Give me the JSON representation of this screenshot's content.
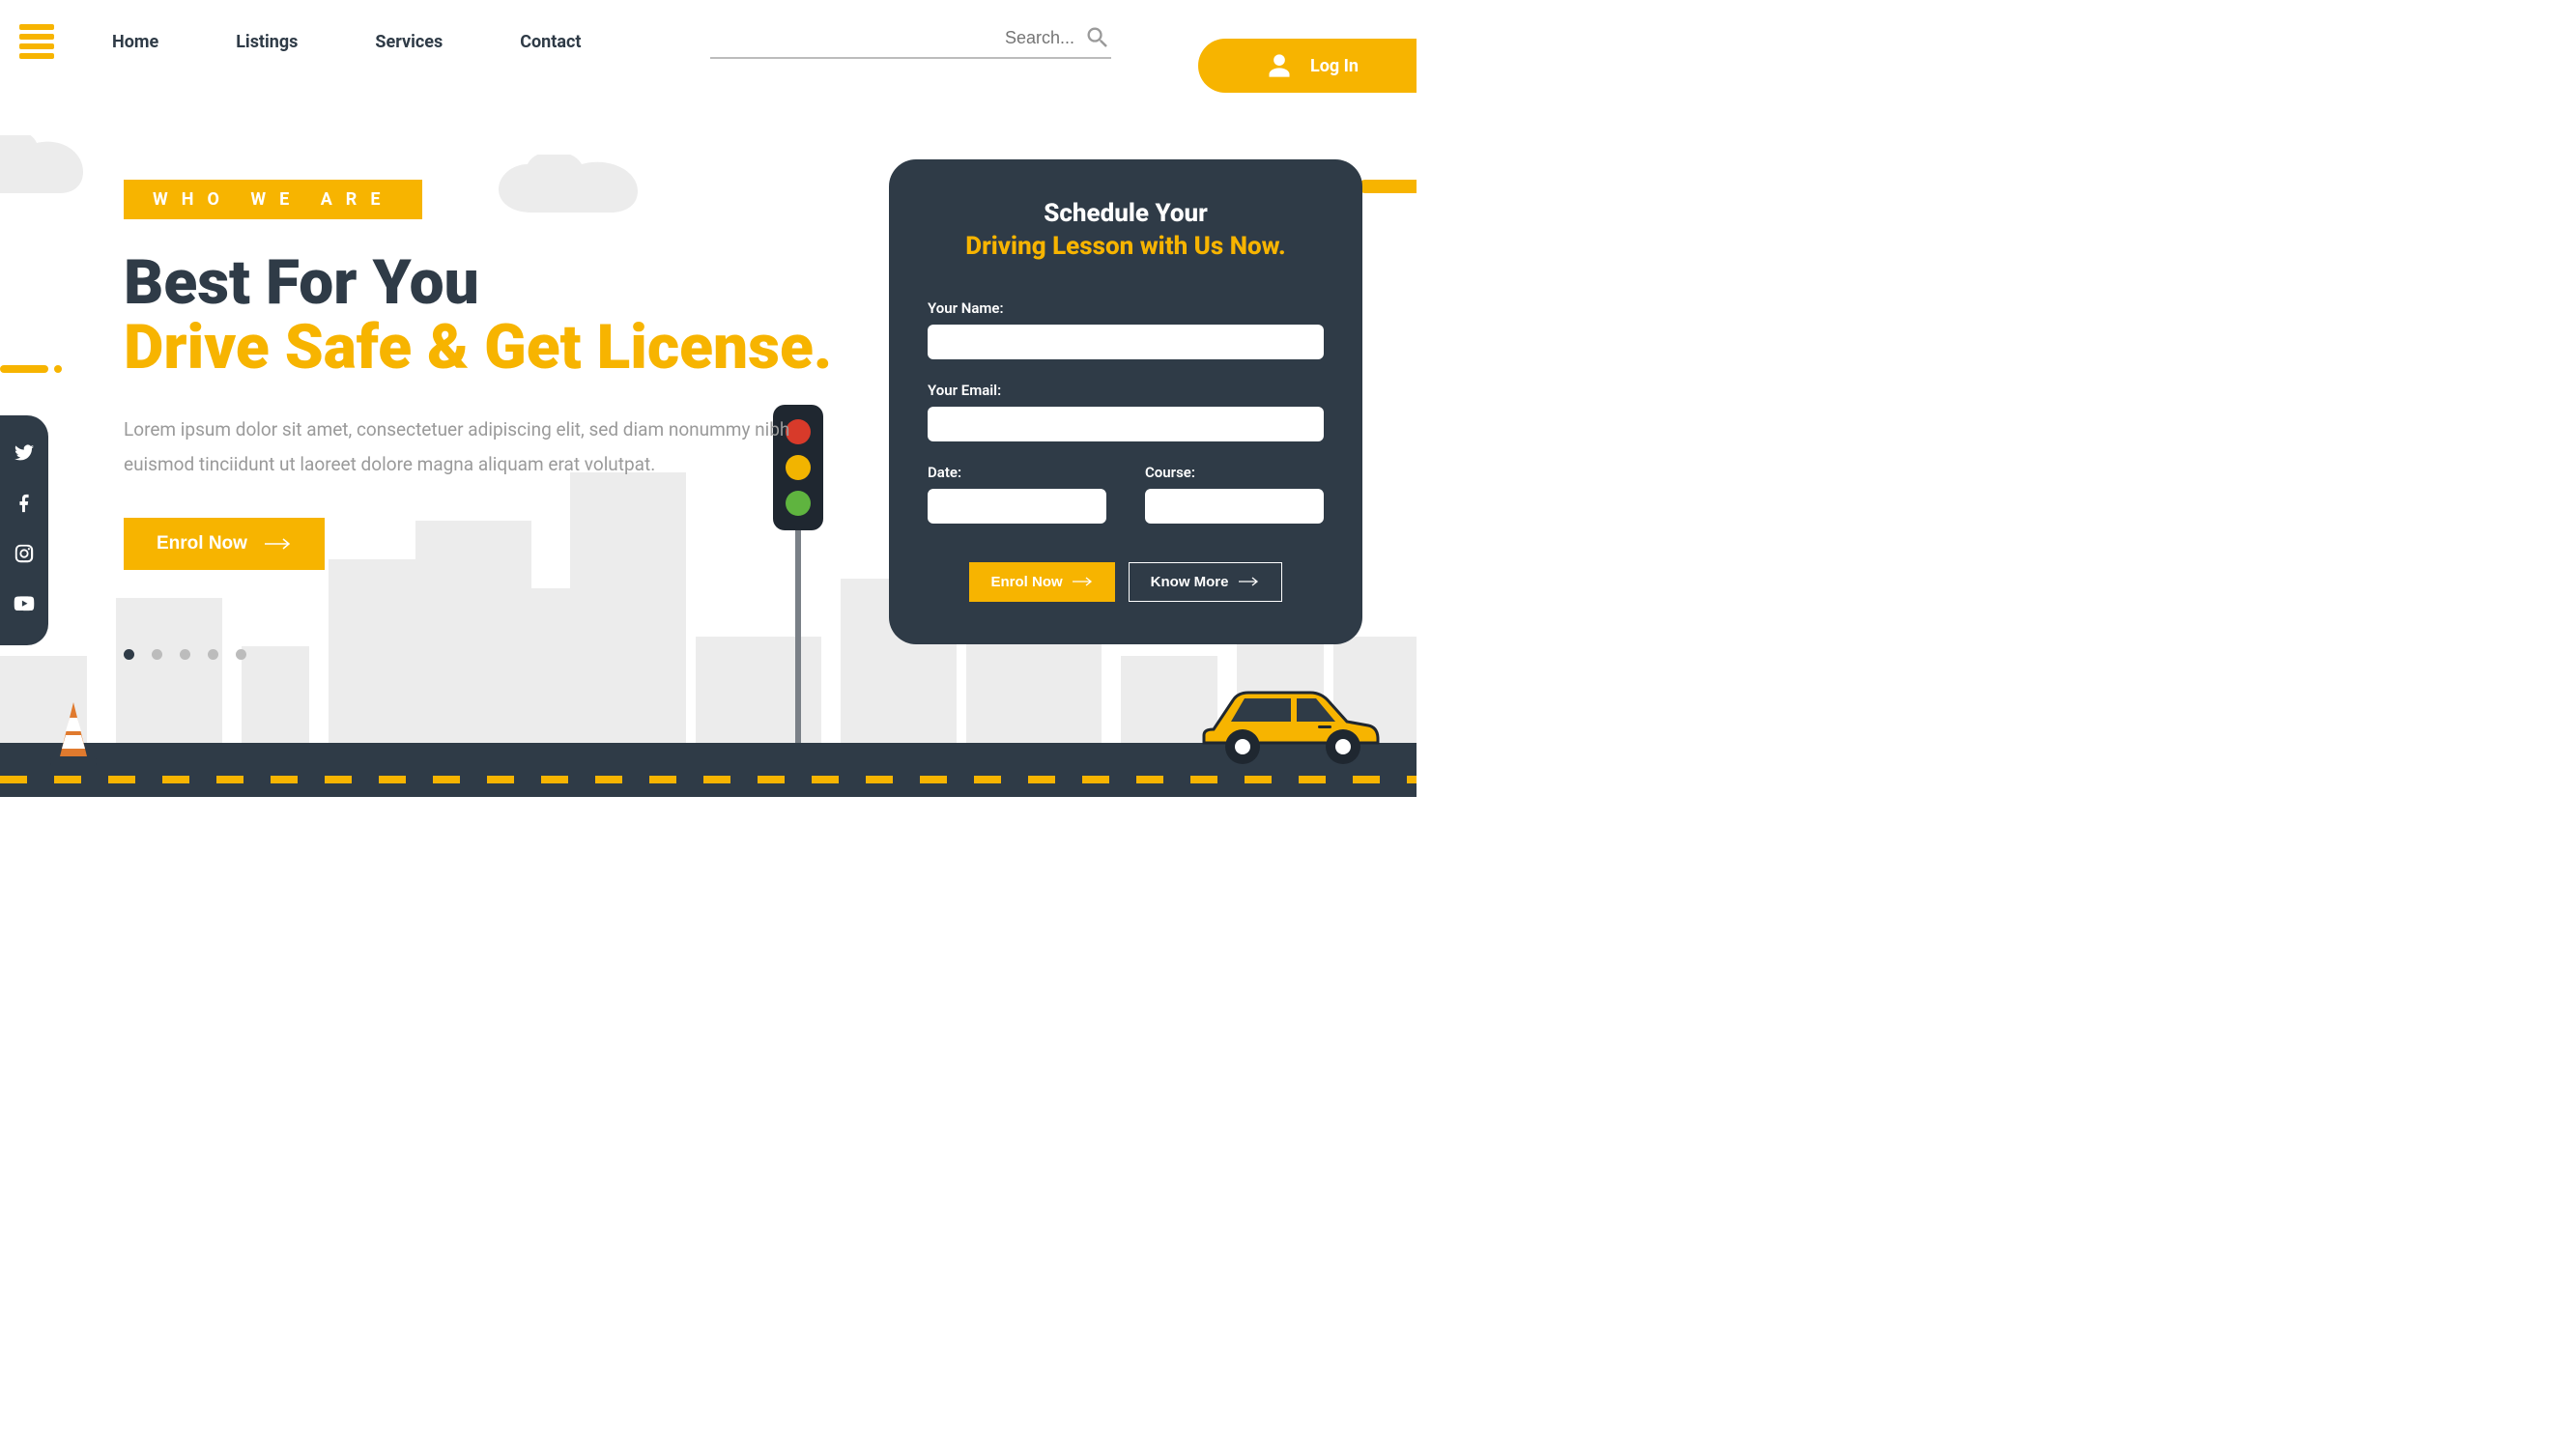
{
  "nav": {
    "items": [
      "Home",
      "Listings",
      "Services",
      "Contact"
    ]
  },
  "search": {
    "placeholder": "Search..."
  },
  "login": {
    "label": "Log In"
  },
  "hero": {
    "tagline": "WHO WE ARE",
    "headline_line1": "Best For You",
    "headline_line2": "Drive Safe & Get License.",
    "desc": "Lorem ipsum dolor sit amet, consectetuer adipiscing elit, sed diam nonummy nibh euismod tinciidunt ut laoreet dolore magna aliquam erat volutpat.",
    "cta": "Enrol Now"
  },
  "form": {
    "title_line1": "Schedule Your",
    "title_line2": "Driving Lesson with Us Now.",
    "name_label": "Your Name:",
    "email_label": "Your Email:",
    "date_label": "Date:",
    "course_label": "Course:",
    "enrol": "Enrol Now",
    "know_more": "Know More"
  },
  "colors": {
    "accent": "#f7b400",
    "dark": "#2f3b47"
  },
  "slider": {
    "count": 5,
    "active": 0
  },
  "social": [
    "twitter",
    "facebook",
    "instagram",
    "youtube"
  ]
}
